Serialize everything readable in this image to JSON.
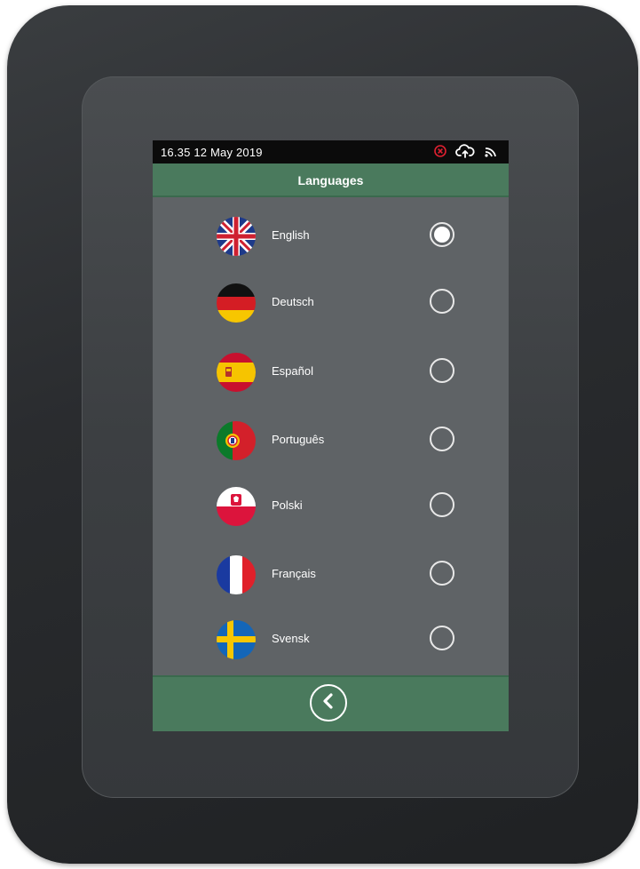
{
  "status_bar": {
    "time_date": "16.35  12 May 2019",
    "icons": [
      "error-icon",
      "cloud-sync-icon",
      "wifi-icon"
    ],
    "error_color": "#e02030"
  },
  "header": {
    "title": "Languages"
  },
  "languages": [
    {
      "label": "English",
      "flag": "uk-flag-icon",
      "selected": true
    },
    {
      "label": "Deutsch",
      "flag": "germany-flag-icon",
      "selected": false
    },
    {
      "label": "Español",
      "flag": "spain-flag-icon",
      "selected": false
    },
    {
      "label": "Português",
      "flag": "portugal-flag-icon",
      "selected": false
    },
    {
      "label": "Polski",
      "flag": "poland-flag-icon",
      "selected": false
    },
    {
      "label": "Français",
      "flag": "france-flag-icon",
      "selected": false
    },
    {
      "label": "Svensk",
      "flag": "sweden-flag-icon",
      "selected": false
    }
  ],
  "footer": {
    "back_icon": "chevron-left-icon"
  },
  "colors": {
    "accent_green": "#4a7a5d",
    "screen_gray": "#5f6366",
    "device_dark": "#2a2c2f"
  }
}
